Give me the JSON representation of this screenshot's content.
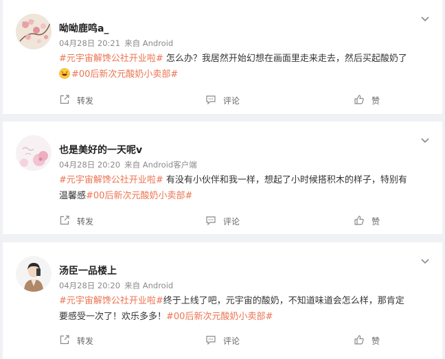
{
  "icons": {
    "menu": "chevron-down-icon",
    "share": "share-icon",
    "comment": "comment-icon",
    "like": "thumbs-up-icon",
    "emoji": "laughing-emoji-icon"
  },
  "colors": {
    "tag": "#eb7350",
    "meta": "#8a8a8a",
    "background": "#f0f1f4"
  },
  "posts": [
    {
      "user": "呦呦鹿鸣a_",
      "time": "04月28日 20:21",
      "source": "来自 Android",
      "tag1": "#元宇宙解馋公社开业啦#",
      "text": " 怎么办？我居然开始幻想在画面里走来走去，然后买起酸奶了",
      "tag2": "#00后新次元酸奶小卖部#",
      "actions": {
        "share": "转发",
        "comment": "评论",
        "like": "赞"
      }
    },
    {
      "user": "也是美好的一天呢v",
      "time": "04月28日 20:20",
      "source": "来自 Android客户端",
      "tag1": "#元宇宙解馋公社开业啦#",
      "text_a": " 有没有小伙伴和我一样，想起了小时候搭积木的样子，特别有",
      "text_b": "温馨感",
      "tag2": "#00后新次元酸奶小卖部#",
      "actions": {
        "share": "转发",
        "comment": "评论",
        "like": "赞"
      }
    },
    {
      "user": "汤臣一品楼上",
      "time": "04月28日 20:20",
      "source": "来自 Android",
      "tag1": "#元宇宙解馋公社开业啦#",
      "text_a": "终于上线了吧，元宇宙的酸奶，不知道味道会怎么样，那肯定",
      "text_b": "要感受一次了！欢乐多多！",
      "tag2": "#00后新次元酸奶小卖部#",
      "actions": {
        "share": "转发",
        "comment": "评论",
        "like": "赞"
      }
    }
  ]
}
